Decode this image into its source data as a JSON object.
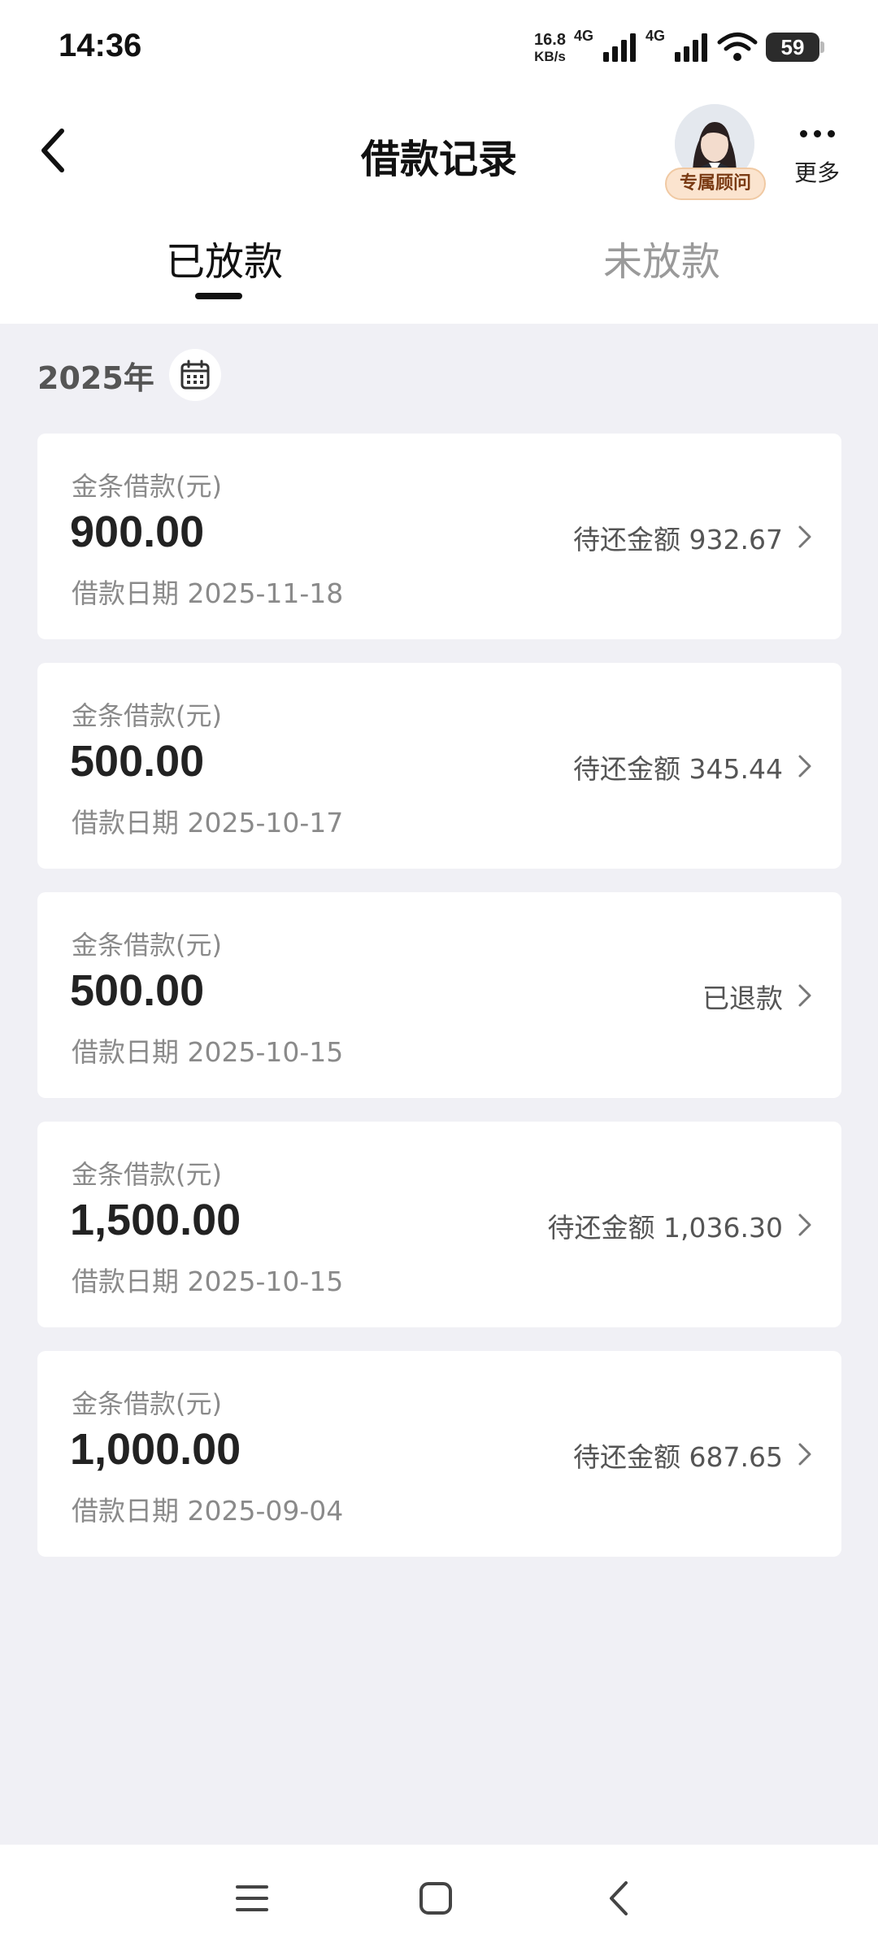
{
  "status_bar": {
    "time": "14:36",
    "net_speed_value": "16.8",
    "net_speed_unit": "KB/s",
    "signal_1_label": "4G",
    "signal_2_label": "4G",
    "battery": "59"
  },
  "header": {
    "title": "借款记录",
    "advisor_label": "专属顾问",
    "more_label": "更多"
  },
  "tabs": [
    {
      "label": "已放款",
      "active": true
    },
    {
      "label": "未放款",
      "active": false
    }
  ],
  "year_filter": {
    "label": "2025年"
  },
  "records": [
    {
      "label": "金条借款(元)",
      "amount": "900.00",
      "date": "借款日期 2025-11-18",
      "status": "待还金额 932.67"
    },
    {
      "label": "金条借款(元)",
      "amount": "500.00",
      "date": "借款日期 2025-10-17",
      "status": "待还金额 345.44"
    },
    {
      "label": "金条借款(元)",
      "amount": "500.00",
      "date": "借款日期 2025-10-15",
      "status": "已退款"
    },
    {
      "label": "金条借款(元)",
      "amount": "1,500.00",
      "date": "借款日期 2025-10-15",
      "status": "待还金额 1,036.30"
    },
    {
      "label": "金条借款(元)",
      "amount": "1,000.00",
      "date": "借款日期 2025-09-04",
      "status": "待还金额 687.65"
    }
  ],
  "icons": {
    "back": "back-arrow-icon",
    "more": "more-dots-icon",
    "calendar": "calendar-icon",
    "chevron": "chevron-right-icon",
    "sys_menu": "menu-icon",
    "sys_home": "home-square-icon",
    "sys_back": "back-triangle-icon"
  },
  "colors": {
    "background": "#f0f0f5",
    "card": "#ffffff",
    "badge_bg": "#fbe4cf"
  }
}
